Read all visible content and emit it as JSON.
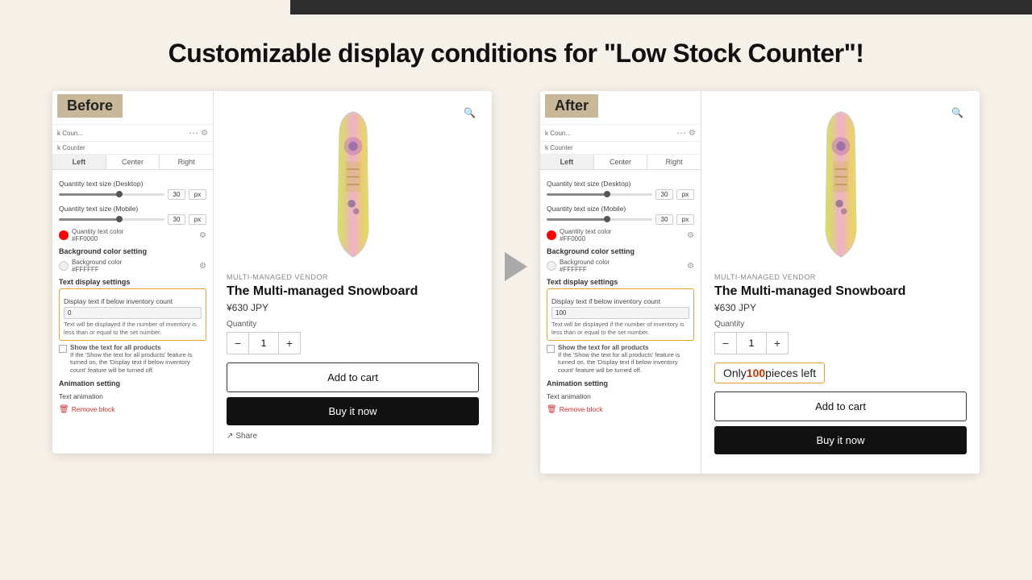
{
  "page": {
    "title": "Customizable display conditions for \"Low Stock Counter\"!",
    "bg_color": "#f5f0e8"
  },
  "before_panel": {
    "badge": "Before",
    "top_bar_text": "k Coun...",
    "subtitle": "k Counter",
    "tabs": [
      "Left",
      "Center",
      "Right"
    ],
    "active_tab": "Left",
    "qty_desktop_label": "Quantity text size (Desktop)",
    "qty_desktop_value": "30",
    "qty_desktop_unit": "px",
    "qty_mobile_label": "Quantity text size (Mobile)",
    "qty_mobile_value": "30",
    "qty_mobile_unit": "px",
    "qty_color_label": "Quantity text color",
    "qty_color_hex": "#FF0000",
    "bg_color_label": "Background color setting",
    "bg_color_sub": "Background color",
    "bg_color_hex": "#FFFFFF",
    "text_display_section": "Text display settings",
    "display_if_label": "Display text if below inventory count",
    "display_if_value": "0",
    "help_text": "Text will be displayed if the number of inventory is less than or equal to the set number.",
    "checkbox_label": "Show the text for all products",
    "checkbox_help": "If the 'Show the text for all products' feature is turned on, the 'Display text if below inventory count' feature will be turned off.",
    "animation_section": "Animation setting",
    "animation_label": "Text animation",
    "remove_block": "Remove block"
  },
  "after_panel": {
    "badge": "After",
    "top_bar_text": "k Coun...",
    "subtitle": "k Counter",
    "tabs": [
      "Left",
      "Center",
      "Right"
    ],
    "active_tab": "Left",
    "qty_desktop_label": "Quantity text size (Desktop)",
    "qty_desktop_value": "30",
    "qty_desktop_unit": "px",
    "qty_mobile_label": "Quantity text size (Mobile)",
    "qty_mobile_value": "30",
    "qty_mobile_unit": "px",
    "qty_color_label": "Quantity text color",
    "qty_color_hex": "#FF0000",
    "bg_color_label": "Background color setting",
    "bg_color_sub": "Background color",
    "bg_color_hex": "#FFFFFF",
    "text_display_section": "Text display settings",
    "display_if_label": "Display text if below inventory count",
    "display_if_value": "100",
    "help_text": "Text will be displayed if the number of inventory is less than or equal to the set number.",
    "checkbox_label": "Show the text for all products",
    "checkbox_help": "If the 'Show the text for all products' feature is turned on, the 'Display text if below inventory count' feature will be turned off.",
    "animation_section": "Animation setting",
    "animation_label": "Text animation",
    "remove_block": "Remove block"
  },
  "product": {
    "vendor": "MULTI-MANAGED VENDOR",
    "title": "The Multi-managed Snowboard",
    "price": "¥630 JPY",
    "quantity_label": "Quantity",
    "quantity_value": "1",
    "add_to_cart": "Add to cart",
    "buy_now": "Buy it now",
    "share": "Share",
    "low_stock_text_before": "Only ",
    "low_stock_number": "100",
    "low_stock_text_after": " pieces left"
  }
}
